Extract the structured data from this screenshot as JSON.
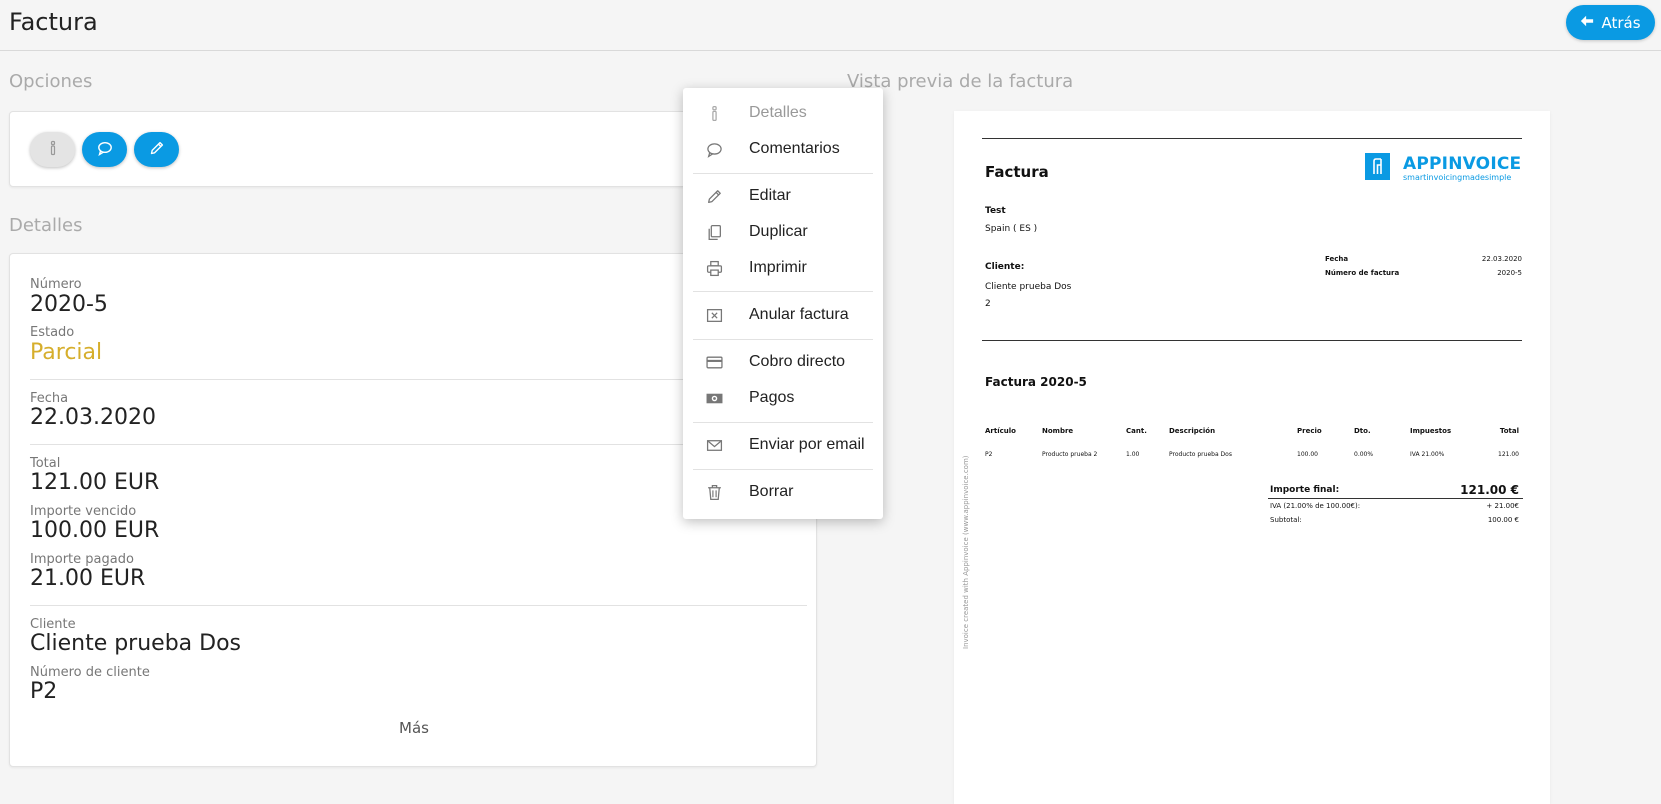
{
  "header": {
    "title": "Factura",
    "back_label": "Atrás"
  },
  "options": {
    "title": "Opciones"
  },
  "details": {
    "title": "Detalles",
    "numero_label": "Número",
    "numero_value": "2020-5",
    "estado_label": "Estado",
    "estado_value": "Parcial",
    "fecha_label": "Fecha",
    "fecha_value": "22.03.2020",
    "total_label": "Total",
    "total_value": "121.00 EUR",
    "vencido_label": "Importe vencido",
    "vencido_value": "100.00 EUR",
    "pagado_label": "Importe pagado",
    "pagado_value": "21.00 EUR",
    "cliente_label": "Cliente",
    "cliente_value": "Cliente prueba Dos",
    "num_cliente_label": "Número de cliente",
    "num_cliente_value": "P2",
    "more_label": "Más"
  },
  "colors": {
    "accent": "#0a9ae3",
    "status_partial": "#d6ae2c"
  },
  "menu": {
    "items": [
      {
        "label": "Detalles",
        "icon": "info-icon",
        "disabled": true
      },
      {
        "label": "Comentarios",
        "icon": "comment-icon"
      },
      {
        "label": "Editar",
        "icon": "pencil-icon"
      },
      {
        "label": "Duplicar",
        "icon": "copy-icon"
      },
      {
        "label": "Imprimir",
        "icon": "printer-icon"
      },
      {
        "label": "Anular factura",
        "icon": "cancel-box-icon"
      },
      {
        "label": "Cobro directo",
        "icon": "credit-card-icon"
      },
      {
        "label": "Pagos",
        "icon": "money-icon"
      },
      {
        "label": "Enviar por email",
        "icon": "envelope-icon"
      },
      {
        "label": "Borrar",
        "icon": "trash-icon"
      }
    ]
  },
  "preview": {
    "section_title": "Vista previa de la factura",
    "doc_title": "Factura",
    "logo_name": "APPINVOICE",
    "logo_sub": "smartinvoicingmadesimple",
    "sender_name": "Test",
    "sender_country": "Spain ( ES )",
    "client_label": "Cliente:",
    "client_name": "Cliente prueba Dos",
    "client_number": "2",
    "fecha_label": "Fecha",
    "fecha_value": "22.03.2020",
    "num_label": "Número de factura",
    "num_value": "2020-5",
    "invoice_heading": "Factura 2020-5",
    "table_headers": [
      "Artículo",
      "Nombre",
      "Cant.",
      "Descripción",
      "Precio",
      "Dto.",
      "Impuestos",
      "Total"
    ],
    "table_row": [
      "P2",
      "Producto prueba 2",
      "1.00",
      "Producto prueba Dos",
      "100.00",
      "0.00%",
      "IVA 21.00%",
      "121.00"
    ],
    "final_label": "Importe final:",
    "final_value": "121.00 €",
    "iva_label": "IVA (21.00% de 100.00€):",
    "iva_value": "+ 21.00€",
    "subtotal_label": "Subtotal:",
    "subtotal_value": "100.00 €",
    "vertical_note": "Invoice created with Appinvoice (www.appinvoice.com)"
  }
}
